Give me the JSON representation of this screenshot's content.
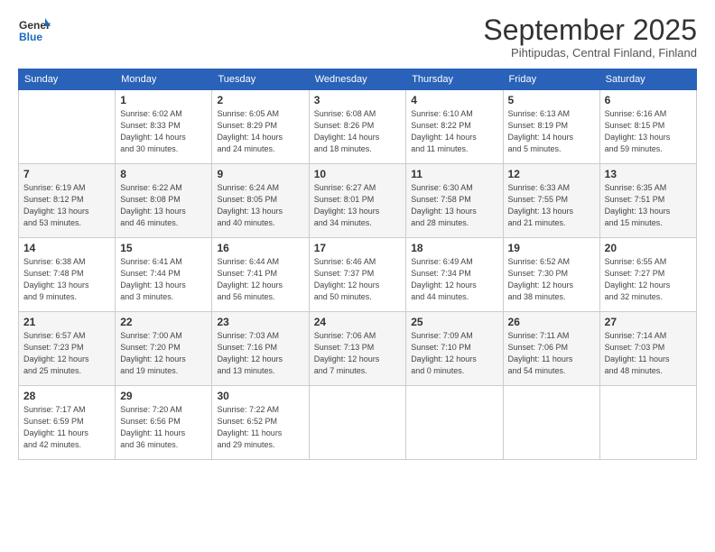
{
  "logo": {
    "general": "General",
    "blue": "Blue"
  },
  "header": {
    "month": "September 2025",
    "location": "Pihtipudas, Central Finland, Finland"
  },
  "days_of_week": [
    "Sunday",
    "Monday",
    "Tuesday",
    "Wednesday",
    "Thursday",
    "Friday",
    "Saturday"
  ],
  "weeks": [
    [
      {
        "day": "",
        "info": ""
      },
      {
        "day": "1",
        "info": "Sunrise: 6:02 AM\nSunset: 8:33 PM\nDaylight: 14 hours\nand 30 minutes."
      },
      {
        "day": "2",
        "info": "Sunrise: 6:05 AM\nSunset: 8:29 PM\nDaylight: 14 hours\nand 24 minutes."
      },
      {
        "day": "3",
        "info": "Sunrise: 6:08 AM\nSunset: 8:26 PM\nDaylight: 14 hours\nand 18 minutes."
      },
      {
        "day": "4",
        "info": "Sunrise: 6:10 AM\nSunset: 8:22 PM\nDaylight: 14 hours\nand 11 minutes."
      },
      {
        "day": "5",
        "info": "Sunrise: 6:13 AM\nSunset: 8:19 PM\nDaylight: 14 hours\nand 5 minutes."
      },
      {
        "day": "6",
        "info": "Sunrise: 6:16 AM\nSunset: 8:15 PM\nDaylight: 13 hours\nand 59 minutes."
      }
    ],
    [
      {
        "day": "7",
        "info": "Sunrise: 6:19 AM\nSunset: 8:12 PM\nDaylight: 13 hours\nand 53 minutes."
      },
      {
        "day": "8",
        "info": "Sunrise: 6:22 AM\nSunset: 8:08 PM\nDaylight: 13 hours\nand 46 minutes."
      },
      {
        "day": "9",
        "info": "Sunrise: 6:24 AM\nSunset: 8:05 PM\nDaylight: 13 hours\nand 40 minutes."
      },
      {
        "day": "10",
        "info": "Sunrise: 6:27 AM\nSunset: 8:01 PM\nDaylight: 13 hours\nand 34 minutes."
      },
      {
        "day": "11",
        "info": "Sunrise: 6:30 AM\nSunset: 7:58 PM\nDaylight: 13 hours\nand 28 minutes."
      },
      {
        "day": "12",
        "info": "Sunrise: 6:33 AM\nSunset: 7:55 PM\nDaylight: 13 hours\nand 21 minutes."
      },
      {
        "day": "13",
        "info": "Sunrise: 6:35 AM\nSunset: 7:51 PM\nDaylight: 13 hours\nand 15 minutes."
      }
    ],
    [
      {
        "day": "14",
        "info": "Sunrise: 6:38 AM\nSunset: 7:48 PM\nDaylight: 13 hours\nand 9 minutes."
      },
      {
        "day": "15",
        "info": "Sunrise: 6:41 AM\nSunset: 7:44 PM\nDaylight: 13 hours\nand 3 minutes."
      },
      {
        "day": "16",
        "info": "Sunrise: 6:44 AM\nSunset: 7:41 PM\nDaylight: 12 hours\nand 56 minutes."
      },
      {
        "day": "17",
        "info": "Sunrise: 6:46 AM\nSunset: 7:37 PM\nDaylight: 12 hours\nand 50 minutes."
      },
      {
        "day": "18",
        "info": "Sunrise: 6:49 AM\nSunset: 7:34 PM\nDaylight: 12 hours\nand 44 minutes."
      },
      {
        "day": "19",
        "info": "Sunrise: 6:52 AM\nSunset: 7:30 PM\nDaylight: 12 hours\nand 38 minutes."
      },
      {
        "day": "20",
        "info": "Sunrise: 6:55 AM\nSunset: 7:27 PM\nDaylight: 12 hours\nand 32 minutes."
      }
    ],
    [
      {
        "day": "21",
        "info": "Sunrise: 6:57 AM\nSunset: 7:23 PM\nDaylight: 12 hours\nand 25 minutes."
      },
      {
        "day": "22",
        "info": "Sunrise: 7:00 AM\nSunset: 7:20 PM\nDaylight: 12 hours\nand 19 minutes."
      },
      {
        "day": "23",
        "info": "Sunrise: 7:03 AM\nSunset: 7:16 PM\nDaylight: 12 hours\nand 13 minutes."
      },
      {
        "day": "24",
        "info": "Sunrise: 7:06 AM\nSunset: 7:13 PM\nDaylight: 12 hours\nand 7 minutes."
      },
      {
        "day": "25",
        "info": "Sunrise: 7:09 AM\nSunset: 7:10 PM\nDaylight: 12 hours\nand 0 minutes."
      },
      {
        "day": "26",
        "info": "Sunrise: 7:11 AM\nSunset: 7:06 PM\nDaylight: 11 hours\nand 54 minutes."
      },
      {
        "day": "27",
        "info": "Sunrise: 7:14 AM\nSunset: 7:03 PM\nDaylight: 11 hours\nand 48 minutes."
      }
    ],
    [
      {
        "day": "28",
        "info": "Sunrise: 7:17 AM\nSunset: 6:59 PM\nDaylight: 11 hours\nand 42 minutes."
      },
      {
        "day": "29",
        "info": "Sunrise: 7:20 AM\nSunset: 6:56 PM\nDaylight: 11 hours\nand 36 minutes."
      },
      {
        "day": "30",
        "info": "Sunrise: 7:22 AM\nSunset: 6:52 PM\nDaylight: 11 hours\nand 29 minutes."
      },
      {
        "day": "",
        "info": ""
      },
      {
        "day": "",
        "info": ""
      },
      {
        "day": "",
        "info": ""
      },
      {
        "day": "",
        "info": ""
      }
    ]
  ]
}
